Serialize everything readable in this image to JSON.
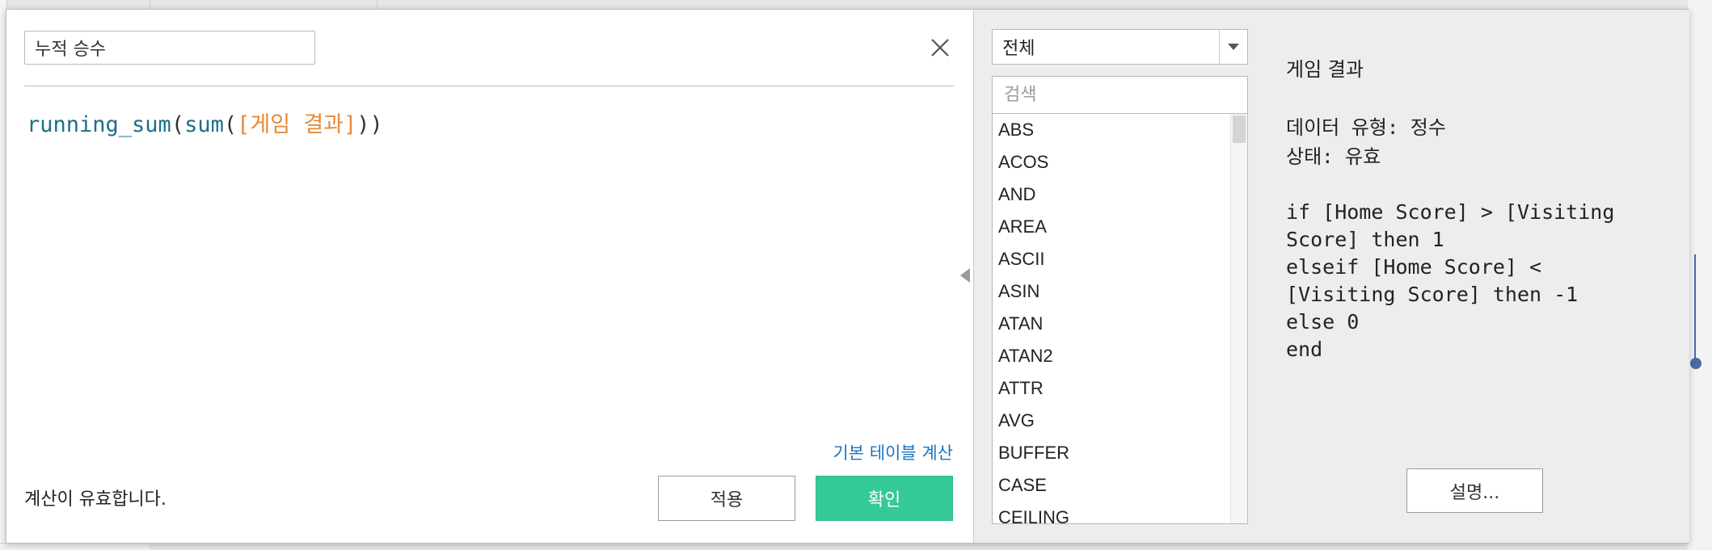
{
  "calc_name": "누적 승수",
  "formula": {
    "fn_outer": "running_sum",
    "open_outer": "(",
    "fn_inner": "sum",
    "open_inner": "(",
    "field": "[게임 결과]",
    "close": "))"
  },
  "links": {
    "default_table_calc": "기본 테이블 계산"
  },
  "status": {
    "message": "계산이 유효합니다."
  },
  "buttons": {
    "apply": "적용",
    "ok": "확인",
    "explain": "설명..."
  },
  "function_panel": {
    "category_selected": "전체",
    "search_placeholder": "검색",
    "functions": [
      "ABS",
      "ACOS",
      "AND",
      "AREA",
      "ASCII",
      "ASIN",
      "ATAN",
      "ATAN2",
      "ATTR",
      "AVG",
      "BUFFER",
      "CASE",
      "CEILING"
    ]
  },
  "help": {
    "title": "게임 결과",
    "data_type": "데이터 유형: 정수",
    "state": "상태: 유효",
    "code": "if [Home Score] > [Visiting Score] then 1\nelseif [Home Score] <\n[Visiting Score] then -1\nelse 0\nend"
  },
  "colors": {
    "accent_button": "#34c997",
    "link": "#1a73c4",
    "function_keyword": "#1c6e8c",
    "field_reference": "#e8893a"
  }
}
